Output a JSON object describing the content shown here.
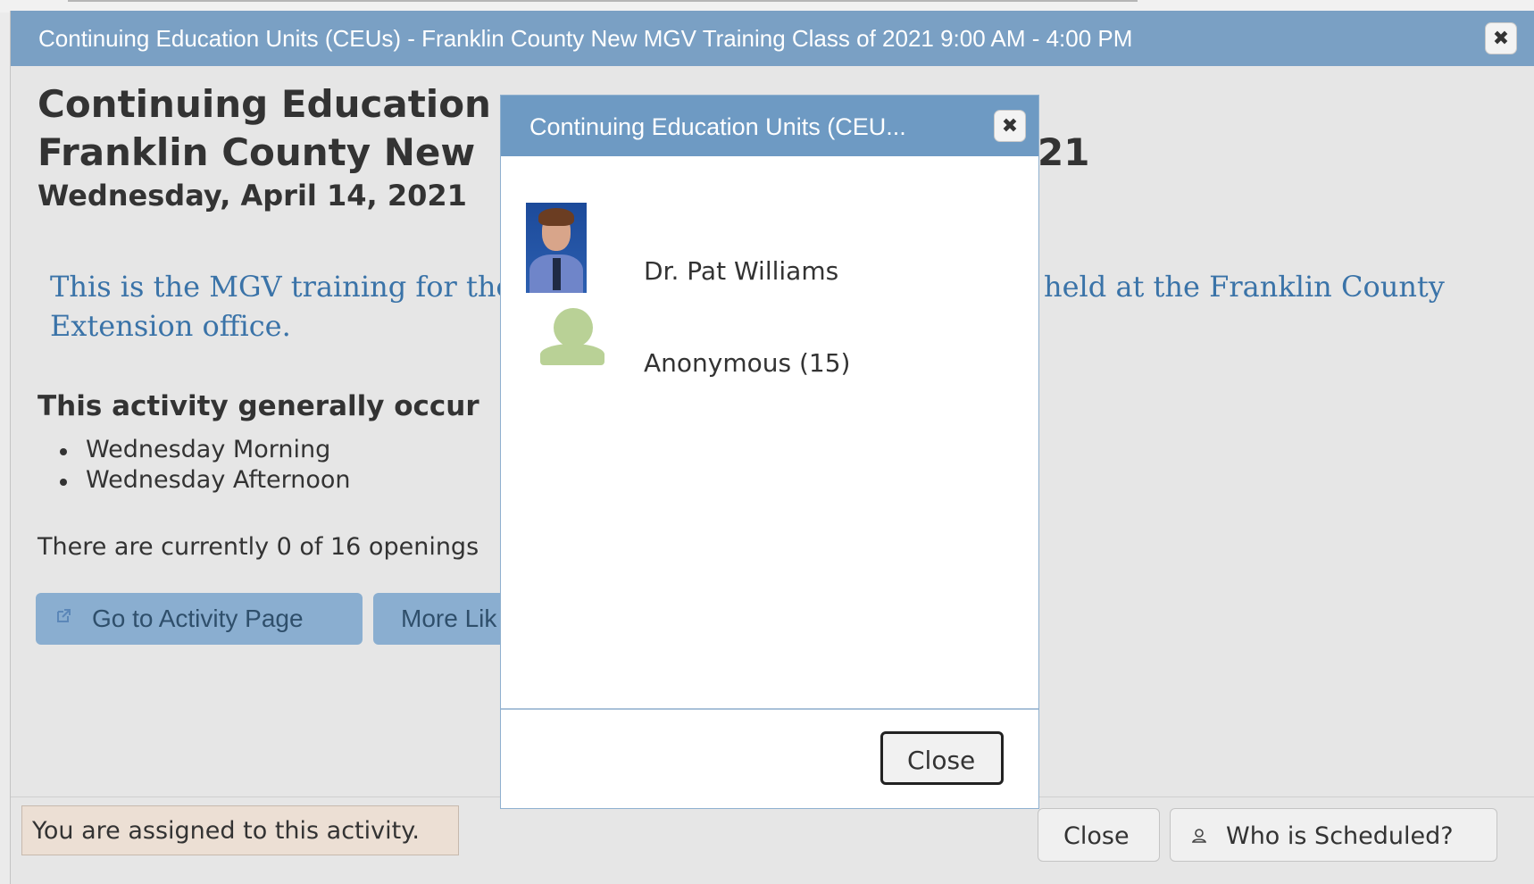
{
  "outer_dialog": {
    "title": "Continuing Education Units (CEUs) - Franklin County New MGV Training Class of 2021 9:00 AM - 4:00 PM",
    "close_icon": "close-icon",
    "heading_line1": "Continuing Education",
    "heading_line2": "Franklin County New",
    "heading_line2_tail": "21",
    "date": "Wednesday, April 14, 2021",
    "description_line1_start": "This is the MGV training for the",
    "description_line1_end": "held at the Franklin County",
    "description_line2": "Extension office.",
    "occurs_heading": "This activity generally occur",
    "occurs_items": [
      "Wednesday Morning",
      "Wednesday Afternoon"
    ],
    "openings_text": "There are currently 0 of 16 openings",
    "go_to_activity_label": "Go to Activity Page",
    "go_to_activity_icon": "external-link-icon",
    "more_like_label": "More Lik",
    "assigned_text": "You are assigned to this activity.",
    "close_label": "Close",
    "who_scheduled_label": "Who is Scheduled?",
    "who_scheduled_icon": "person-icon"
  },
  "modal": {
    "title": "Continuing Education Units (CEU...",
    "close_icon": "close-icon",
    "people": [
      {
        "name": "Dr. Pat Williams",
        "avatar": "person-photo"
      },
      {
        "name": "Anonymous (15)",
        "avatar": "anonymous-avatar-icon"
      }
    ],
    "close_label": "Close"
  },
  "colors": {
    "title_bar": "#7aa0c4",
    "modal_title_bar": "#6e9ac3",
    "link_text": "#3a73a8",
    "button_blue": "#8aaed0",
    "assigned_bg": "#ecdfd4"
  }
}
